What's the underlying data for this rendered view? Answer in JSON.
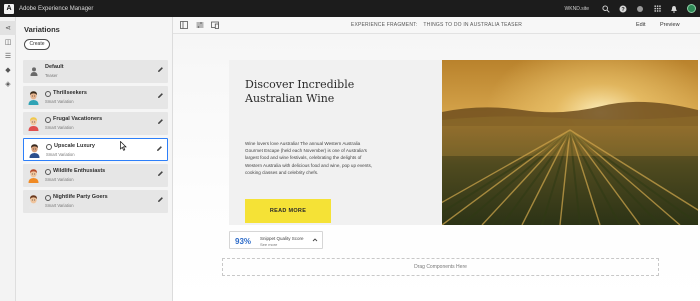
{
  "app": {
    "logo_letter": "A",
    "title": "Adobe Experience Manager",
    "site": "WKND.site",
    "search_icon": "search-icon",
    "help_icon": "help-icon",
    "bell_icon": "bell-icon",
    "apps_icon": "apps-grid-icon",
    "avatar_color": "#2f8a57"
  },
  "rail": {
    "items": [
      {
        "icon": "share-icon",
        "glyph": "⋖"
      },
      {
        "icon": "variations-icon",
        "glyph": "◫"
      },
      {
        "icon": "tree-icon",
        "glyph": "☰"
      },
      {
        "icon": "assets-icon",
        "glyph": "◆"
      },
      {
        "icon": "layers-icon",
        "glyph": "◈"
      }
    ]
  },
  "panel": {
    "heading": "Variations",
    "create_label": "Create",
    "variations": [
      {
        "name": "Default",
        "sub": "Teaser",
        "thumb": "generic",
        "smart": false
      },
      {
        "name": "Thrillseekers",
        "sub": "Smart Variation",
        "thumb": "thrillseeker",
        "smart": true
      },
      {
        "name": "Frugal Vacationers",
        "sub": "Smart Variation",
        "thumb": "frugal",
        "smart": true
      },
      {
        "name": "Upscale Luxury",
        "sub": "Smart Variation",
        "thumb": "upscale",
        "smart": true
      },
      {
        "name": "Wildlife Enthusiasts",
        "sub": "Smart Variation",
        "thumb": "wildlife",
        "smart": true
      },
      {
        "name": "Nightlife Party Goers",
        "sub": "Smart Variation",
        "thumb": "nightlife",
        "smart": true
      }
    ],
    "selected_index": 3
  },
  "toolbar": {
    "crumb_label": "EXPERIENCE FRAGMENT:",
    "crumb_value": "THINGS TO DO IN AUSTRALIA TEASER",
    "edit_label": "Edit",
    "preview_label": "Preview"
  },
  "teaser": {
    "title": "Discover Incredible Australian Wine",
    "body": "Wine lovers love Australia! The annual Western Australia Gourmet Escape (held each November) is one of Australia's largest food and wine festivals, celebrating the delights of Western Australia with delicious food and wine, pop up events, cooking classes and celebrity chefs.",
    "cta": "READ MORE",
    "cta_color": "#f5e236"
  },
  "quality": {
    "score": "93%",
    "label": "Snippet Quality Score",
    "see_more": "See more"
  },
  "dropzone": {
    "label": "Drag Components Here"
  }
}
